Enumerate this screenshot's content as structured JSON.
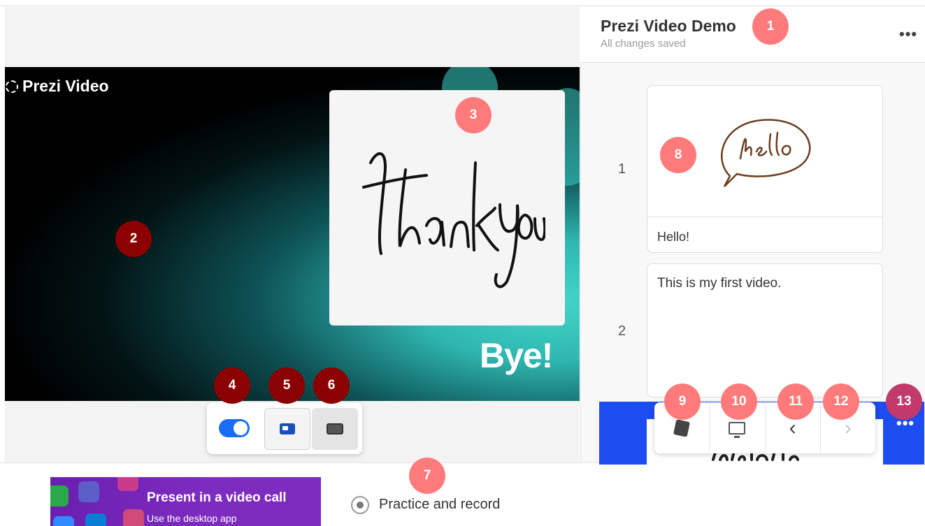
{
  "app": {
    "brand": "Prezi Video"
  },
  "header": {
    "title": "Prezi Video Demo",
    "status": "All changes saved",
    "more_label": "•••"
  },
  "stage": {
    "card_text": "thank you",
    "overlay_text": "Bye!"
  },
  "layout_controls": {
    "toggle_on": true,
    "options": [
      "picture-in-picture",
      "fullscreen"
    ]
  },
  "slides": [
    {
      "number": "1",
      "thumb_text": "hello",
      "caption": "Hello!"
    },
    {
      "number": "2",
      "caption": "This is my first video."
    }
  ],
  "slide_peek_text": "thank you",
  "toolbar": {
    "items": [
      "cards-icon",
      "monitor-icon",
      "chevron-left-icon",
      "chevron-right-icon"
    ],
    "prev": "‹",
    "next": "›",
    "more_label": "•••"
  },
  "bottom": {
    "video_call_title": "Present in a video call",
    "video_call_sub": "Use the desktop app",
    "practice_label": "Practice and record"
  },
  "markers": [
    "1",
    "2",
    "3",
    "4",
    "5",
    "6",
    "7",
    "8",
    "9",
    "10",
    "11",
    "12",
    "13"
  ],
  "colors": {
    "marker_light": "#ff7b7b",
    "marker_dark": "#8b0000",
    "accent_blue": "#1a6ef5",
    "strip_blue": "#1d4cf0",
    "purple": "#6a1fb0"
  }
}
